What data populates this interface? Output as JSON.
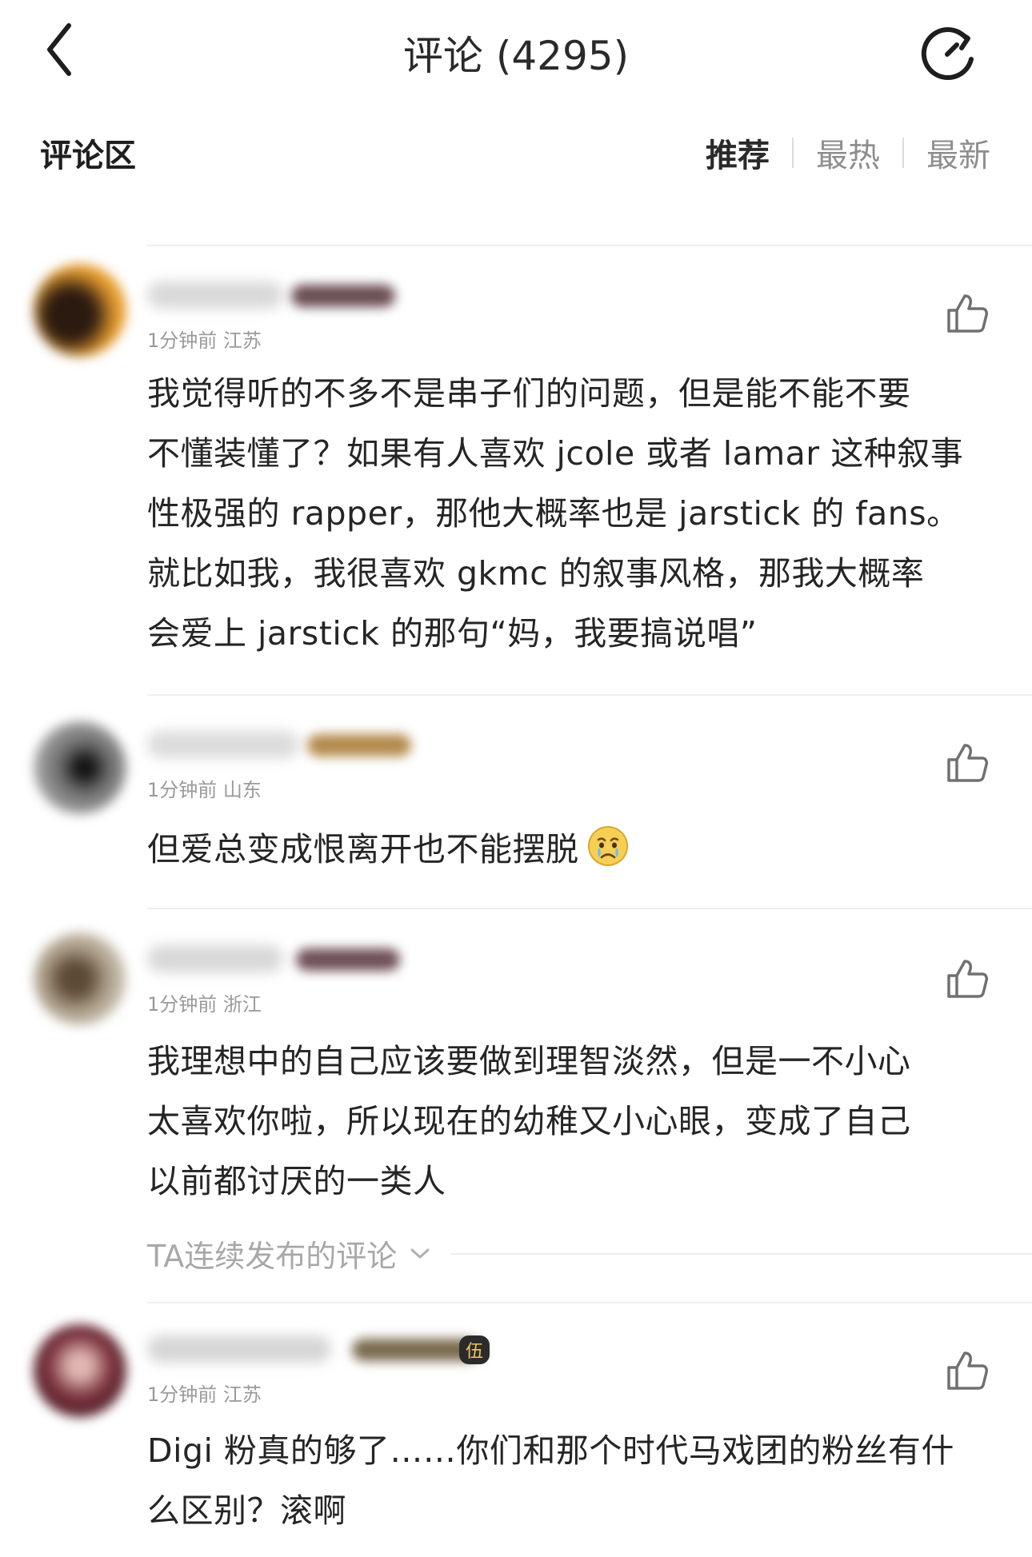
{
  "header": {
    "title": "评论 (4295)"
  },
  "section": {
    "title": "评论区",
    "sort_tabs": [
      {
        "label": "推荐",
        "active": true
      },
      {
        "label": "最热",
        "active": false
      },
      {
        "label": "最新",
        "active": false
      }
    ]
  },
  "comments": [
    {
      "meta": "1分钟前 江苏",
      "text_lines": [
        "我觉得听的不多不是串子们的问题，但是能不能不要",
        "不懂装懂了？如果有人喜欢 jcole 或者 lamar 这种叙事",
        "性极强的 rapper，那他大概率也是 jarstick 的 fans。",
        "就比如我，我很喜欢 gkmc 的叙事风格，那我大概率",
        "会爱上 jarstick 的那句“妈，我要搞说唱”"
      ]
    },
    {
      "meta": "1分钟前 山东",
      "text_lines": [
        "但爱总变成恨离开也不能摆脱"
      ],
      "emoji": "crying-face"
    },
    {
      "meta": "1分钟前 浙江",
      "text_lines": [
        "我理想中的自己应该要做到理智淡然，但是一不小心",
        "太喜欢你啦，所以现在的幼稚又小心眼，变成了自己",
        "以前都讨厌的一类人"
      ],
      "reply_link": "TA连续发布的评论"
    },
    {
      "meta": "1分钟前 江苏",
      "badge_text": "伍",
      "text_lines": [
        "Digi 粉真的够了……你们和那个时代马戏团的粉丝有什",
        "么区别？滚啊"
      ]
    }
  ],
  "colors": {
    "text_primary": "#252525",
    "text_meta": "#9a9a9a",
    "divider": "#eeeeee",
    "background": "#ffffff"
  },
  "icons": [
    "back-arrow-icon",
    "refresh-icon",
    "thumbs-up-icon",
    "chevron-down-icon",
    "crying-face-emoji"
  ]
}
